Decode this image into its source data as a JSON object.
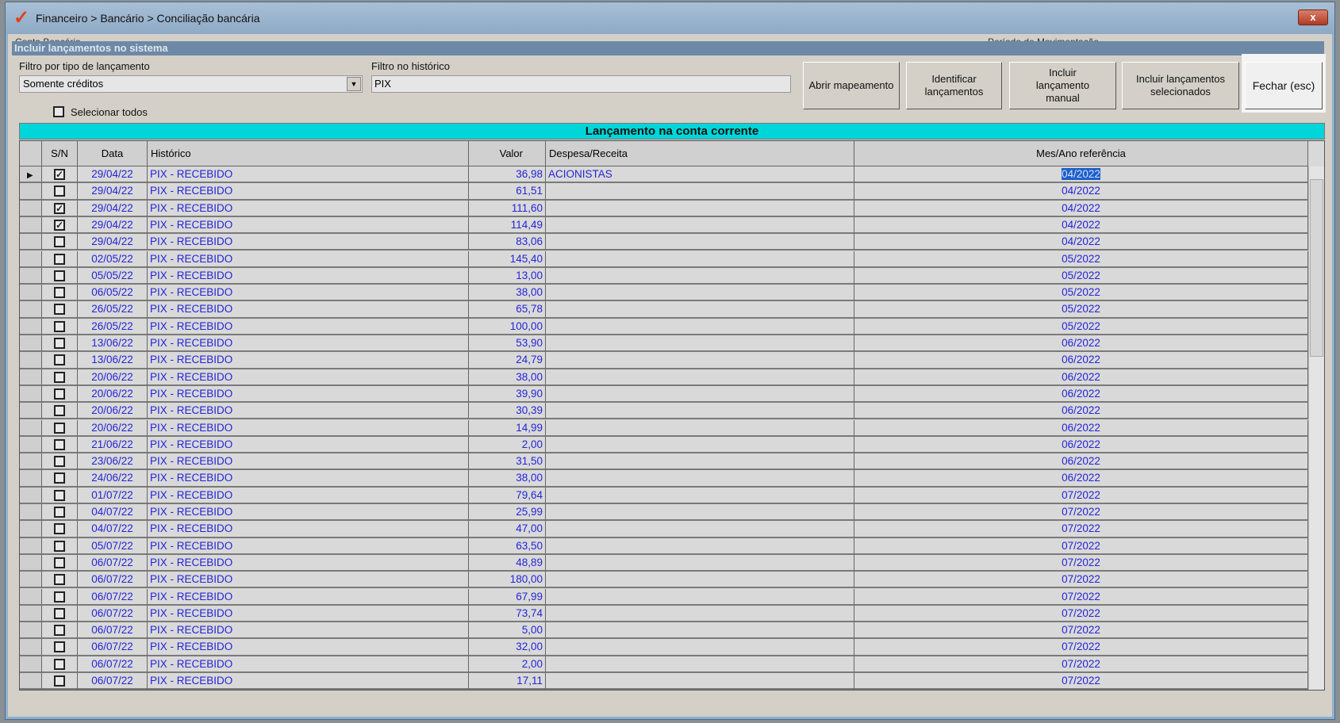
{
  "window": {
    "title": "Financeiro > Bancário > Conciliação bancária",
    "close_label": "x",
    "ghost_left": "Conta Bancária",
    "ghost_right": "Período de Movimentação"
  },
  "panel": {
    "title": "Incluir lançamentos no sistema"
  },
  "filters": {
    "type_label": "Filtro por tipo de lançamento",
    "type_value": "Somente créditos",
    "history_label": "Filtro no histórico",
    "history_value": "PIX",
    "select_all_label": "Selecionar todos"
  },
  "buttons": {
    "open_mapping": "Abrir mapeamento",
    "identify": "Identificar lançamentos",
    "include_manual": "Incluir lançamento manual",
    "include_selected": "Incluir lançamentos selecionados",
    "close": "Fechar (esc)"
  },
  "grid": {
    "title": "Lançamento na conta corrente",
    "columns": {
      "sn": "S/N",
      "date": "Data",
      "history": "Histórico",
      "value": "Valor",
      "category": "Despesa/Receita",
      "ref": "Mes/Ano referência"
    },
    "rows": [
      {
        "checked": true,
        "date": "29/04/22",
        "history": "PIX - RECEBIDO",
        "value": "36,98",
        "category": "ACIONISTAS",
        "ref": "04/2022",
        "current": true
      },
      {
        "checked": false,
        "date": "29/04/22",
        "history": "PIX - RECEBIDO",
        "value": "61,51",
        "category": "",
        "ref": "04/2022"
      },
      {
        "checked": true,
        "date": "29/04/22",
        "history": "PIX - RECEBIDO",
        "value": "111,60",
        "category": "",
        "ref": "04/2022"
      },
      {
        "checked": true,
        "date": "29/04/22",
        "history": "PIX - RECEBIDO",
        "value": "114,49",
        "category": "",
        "ref": "04/2022"
      },
      {
        "checked": false,
        "date": "29/04/22",
        "history": "PIX - RECEBIDO",
        "value": "83,06",
        "category": "",
        "ref": "04/2022"
      },
      {
        "checked": false,
        "date": "02/05/22",
        "history": "PIX - RECEBIDO",
        "value": "145,40",
        "category": "",
        "ref": "05/2022"
      },
      {
        "checked": false,
        "date": "05/05/22",
        "history": "PIX - RECEBIDO",
        "value": "13,00",
        "category": "",
        "ref": "05/2022"
      },
      {
        "checked": false,
        "date": "06/05/22",
        "history": "PIX - RECEBIDO",
        "value": "38,00",
        "category": "",
        "ref": "05/2022"
      },
      {
        "checked": false,
        "date": "26/05/22",
        "history": "PIX - RECEBIDO",
        "value": "65,78",
        "category": "",
        "ref": "05/2022"
      },
      {
        "checked": false,
        "date": "26/05/22",
        "history": "PIX - RECEBIDO",
        "value": "100,00",
        "category": "",
        "ref": "05/2022"
      },
      {
        "checked": false,
        "date": "13/06/22",
        "history": "PIX - RECEBIDO",
        "value": "53,90",
        "category": "",
        "ref": "06/2022"
      },
      {
        "checked": false,
        "date": "13/06/22",
        "history": "PIX - RECEBIDO",
        "value": "24,79",
        "category": "",
        "ref": "06/2022"
      },
      {
        "checked": false,
        "date": "20/06/22",
        "history": "PIX - RECEBIDO",
        "value": "38,00",
        "category": "",
        "ref": "06/2022"
      },
      {
        "checked": false,
        "date": "20/06/22",
        "history": "PIX - RECEBIDO",
        "value": "39,90",
        "category": "",
        "ref": "06/2022"
      },
      {
        "checked": false,
        "date": "20/06/22",
        "history": "PIX - RECEBIDO",
        "value": "30,39",
        "category": "",
        "ref": "06/2022"
      },
      {
        "checked": false,
        "date": "20/06/22",
        "history": "PIX - RECEBIDO",
        "value": "14,99",
        "category": "",
        "ref": "06/2022"
      },
      {
        "checked": false,
        "date": "21/06/22",
        "history": "PIX - RECEBIDO",
        "value": "2,00",
        "category": "",
        "ref": "06/2022"
      },
      {
        "checked": false,
        "date": "23/06/22",
        "history": "PIX - RECEBIDO",
        "value": "31,50",
        "category": "",
        "ref": "06/2022"
      },
      {
        "checked": false,
        "date": "24/06/22",
        "history": "PIX - RECEBIDO",
        "value": "38,00",
        "category": "",
        "ref": "06/2022"
      },
      {
        "checked": false,
        "date": "01/07/22",
        "history": "PIX - RECEBIDO",
        "value": "79,64",
        "category": "",
        "ref": "07/2022"
      },
      {
        "checked": false,
        "date": "04/07/22",
        "history": "PIX - RECEBIDO",
        "value": "25,99",
        "category": "",
        "ref": "07/2022"
      },
      {
        "checked": false,
        "date": "04/07/22",
        "history": "PIX - RECEBIDO",
        "value": "47,00",
        "category": "",
        "ref": "07/2022"
      },
      {
        "checked": false,
        "date": "05/07/22",
        "history": "PIX - RECEBIDO",
        "value": "63,50",
        "category": "",
        "ref": "07/2022"
      },
      {
        "checked": false,
        "date": "06/07/22",
        "history": "PIX - RECEBIDO",
        "value": "48,89",
        "category": "",
        "ref": "07/2022"
      },
      {
        "checked": false,
        "date": "06/07/22",
        "history": "PIX - RECEBIDO",
        "value": "180,00",
        "category": "",
        "ref": "07/2022"
      },
      {
        "checked": false,
        "date": "06/07/22",
        "history": "PIX - RECEBIDO",
        "value": "67,99",
        "category": "",
        "ref": "07/2022"
      },
      {
        "checked": false,
        "date": "06/07/22",
        "history": "PIX - RECEBIDO",
        "value": "73,74",
        "category": "",
        "ref": "07/2022"
      },
      {
        "checked": false,
        "date": "06/07/22",
        "history": "PIX - RECEBIDO",
        "value": "5,00",
        "category": "",
        "ref": "07/2022"
      },
      {
        "checked": false,
        "date": "06/07/22",
        "history": "PIX - RECEBIDO",
        "value": "32,00",
        "category": "",
        "ref": "07/2022"
      },
      {
        "checked": false,
        "date": "06/07/22",
        "history": "PIX - RECEBIDO",
        "value": "2,00",
        "category": "",
        "ref": "07/2022"
      },
      {
        "checked": false,
        "date": "06/07/22",
        "history": "PIX - RECEBIDO",
        "value": "17,11",
        "category": "",
        "ref": "07/2022"
      }
    ]
  },
  "colors": {
    "accent": "#00d6d9",
    "text_blue": "#2525d8",
    "panel_title": "#6e89a6"
  }
}
